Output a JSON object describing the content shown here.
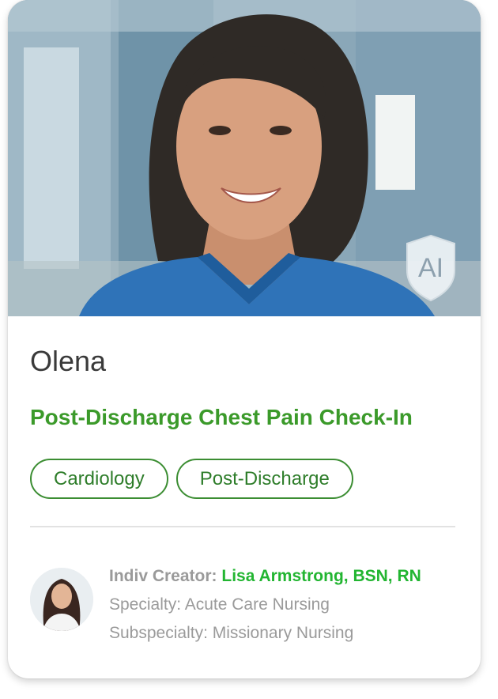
{
  "profile": {
    "name": "Olena",
    "title": "Post-Discharge Chest Pain Check-In",
    "ai_badge": "AI",
    "photo_icon": "nurse-portrait",
    "tags": [
      "Cardiology",
      "Post-Discharge"
    ]
  },
  "creator": {
    "label": "Indiv Creator:",
    "name": "Lisa Armstrong, BSN, RN",
    "specialty": "Specialty: Acute Care Nursing",
    "subspecialty": "Subspecialty: Missionary Nursing",
    "avatar_icon": "creator-avatar"
  },
  "colors": {
    "accent_green": "#3b9a2a",
    "creator_green": "#22b531",
    "tag_border": "#3b8d32",
    "muted_text": "#9a9a9a"
  }
}
